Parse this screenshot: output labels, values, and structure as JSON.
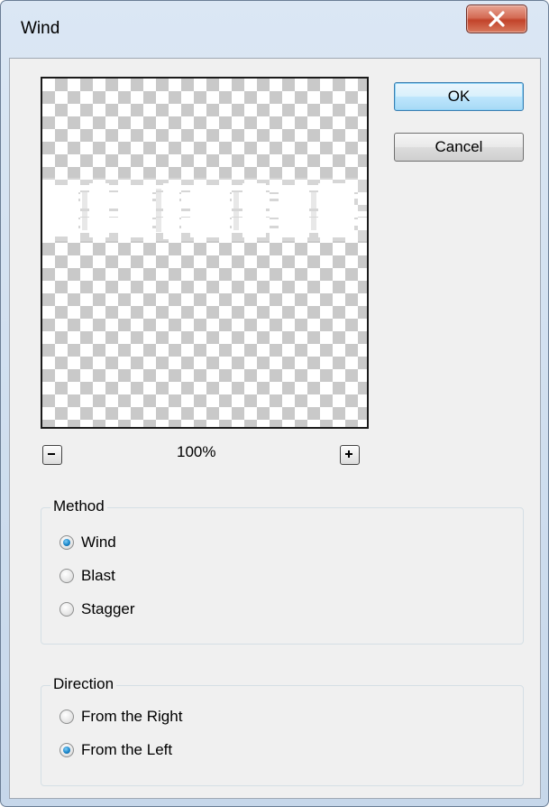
{
  "window": {
    "title": "Wind"
  },
  "title_bar": {
    "close_icon": "close-x-icon"
  },
  "buttons": {
    "ok_label": "OK",
    "cancel_label": "Cancel"
  },
  "preview": {
    "zoom": "100%",
    "zoom_out_icon": "minus-icon",
    "zoom_in_icon": "plus-icon"
  },
  "method": {
    "label": "Method",
    "options": [
      {
        "label": "Wind",
        "checked": true
      },
      {
        "label": "Blast",
        "checked": false
      },
      {
        "label": "Stagger",
        "checked": false
      }
    ]
  },
  "direction": {
    "label": "Direction",
    "options": [
      {
        "label": "From the Right",
        "checked": false
      },
      {
        "label": "From the Left",
        "checked": true
      }
    ]
  },
  "colors": {
    "accent": "#1a86c9",
    "close_button": "#c2432a",
    "dialog_bg": "#f0f0f0"
  }
}
